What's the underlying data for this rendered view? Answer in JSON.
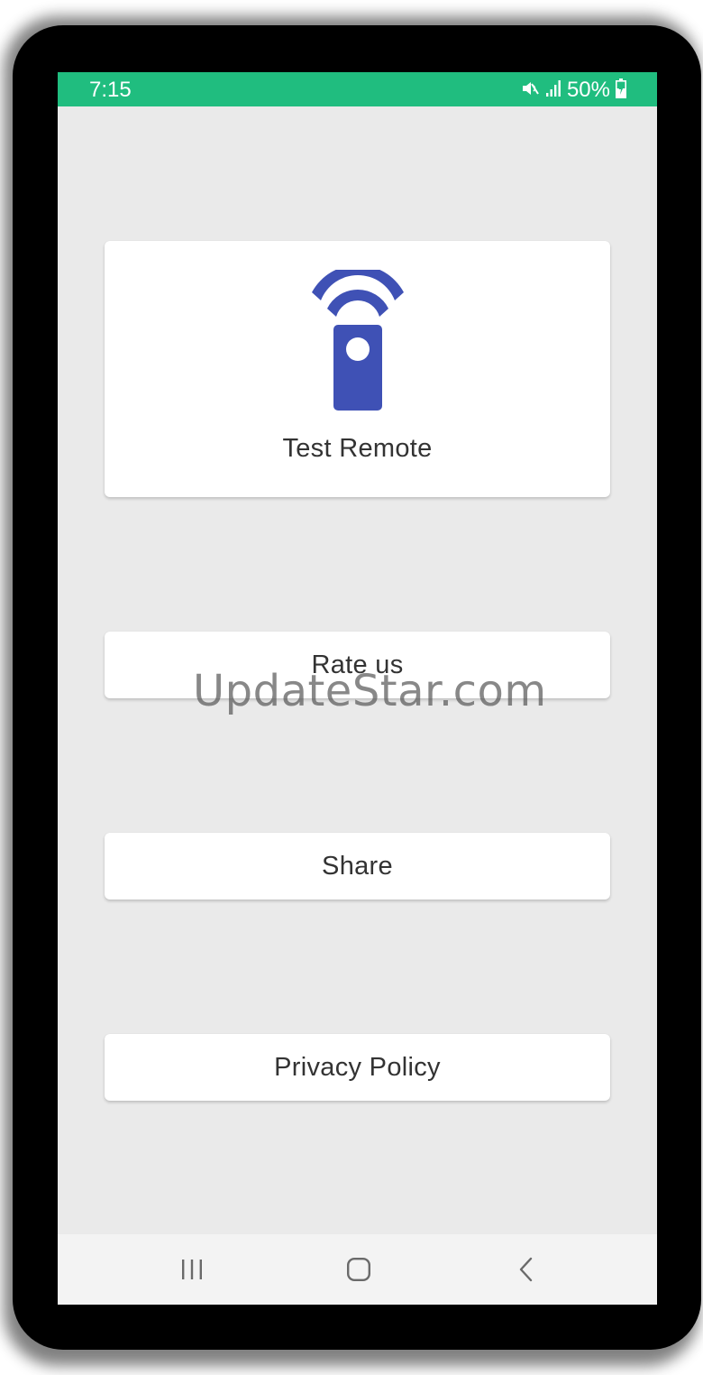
{
  "status_bar": {
    "time": "7:15",
    "battery": "50%",
    "icons": [
      "mute-icon",
      "signal-icon",
      "battery-charging-icon"
    ],
    "color": "#20bd7f"
  },
  "main": {
    "test_remote": {
      "label": "Test Remote",
      "icon": "remote-control-icon",
      "icon_color": "#3f51b5"
    },
    "rate_us": {
      "label": "Rate us"
    },
    "share": {
      "label": "Share"
    },
    "privacy_policy": {
      "label": "Privacy Policy"
    }
  },
  "watermark": "UpdateStar.com",
  "nav_bar": {
    "icons": [
      "recent-apps-icon",
      "home-icon",
      "back-icon"
    ]
  }
}
